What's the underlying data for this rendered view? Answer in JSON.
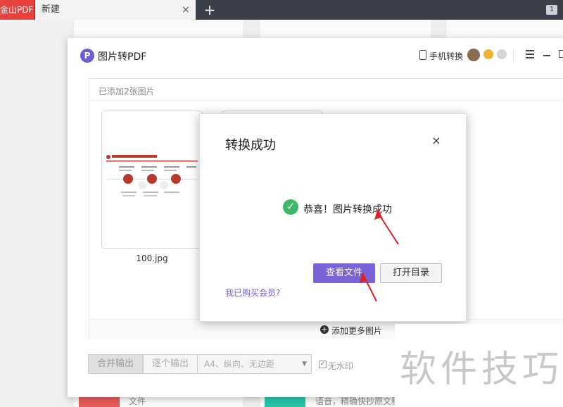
{
  "tabs": {
    "app_tab_label": "金山PDF",
    "active_tab_label": "新建",
    "close_glyph": "×",
    "new_tab_glyph": "+",
    "badge": "1"
  },
  "background": {
    "card1_text": "文件",
    "card2_text": "语音，精确快抄原文稿"
  },
  "window": {
    "logo_glyph": "P",
    "title": "图片转PDF",
    "phone_convert_label": "手机转换",
    "added_count_label": "已添加2张图片",
    "thumbnail_name": "100.jpg",
    "add_more_label": "添加更多图片",
    "merge_output_label": "合并输出",
    "individual_output_label": "逐个输出",
    "page_setting_value": "A4、纵向、无边距",
    "no_watermark_label": "无水印"
  },
  "modal": {
    "title": "转换成功",
    "close_glyph": "×",
    "success_message": "恭喜！图片转换成功",
    "view_file_label": "查看文件",
    "open_folder_label": "打开目录",
    "member_link": "我已购买会员?"
  },
  "watermark_text": "软件技巧",
  "colors": {
    "brand": "#6b5fd6",
    "primary_button": "#7a62d8",
    "success": "#3db865",
    "annotation": "#e02020",
    "app_tab": "#e8423c"
  }
}
